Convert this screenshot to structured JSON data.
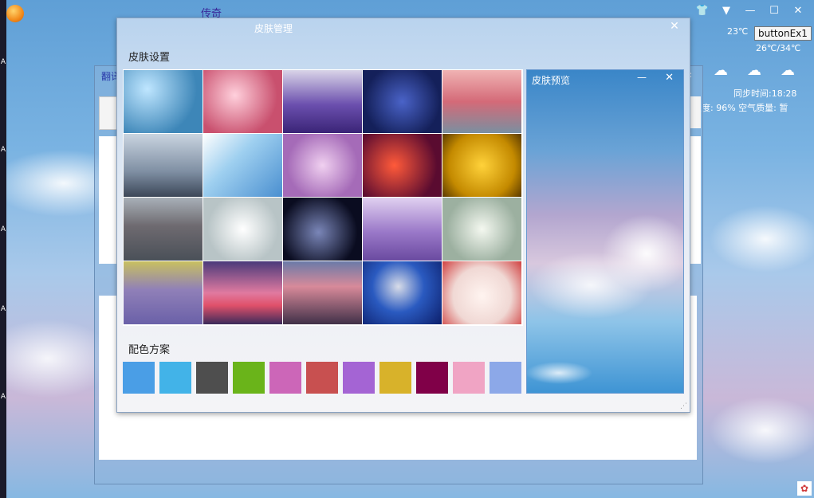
{
  "main": {
    "title": "传奇",
    "controls": [
      "👕",
      "▼",
      "—",
      "☐",
      "✕"
    ]
  },
  "tooltip": "buttonEx1",
  "weather": {
    "current_temp": "23℃",
    "range": "26℃/34℃",
    "sync_time": "同步时间:18:28",
    "humidity_air": "度: 96% 空气质量: 暂"
  },
  "background_window": {
    "title": "翻译"
  },
  "skin_manager": {
    "title": "皮肤管理",
    "close": "✕",
    "section_skin": "皮肤设置",
    "section_colors": "配色方案",
    "tiles": [
      {
        "name": "blue-bokeh",
        "bg": "radial-gradient(circle at 30% 30%,#bfe6ff,#3d86b8 70%)"
      },
      {
        "name": "pink-blossoms",
        "bg": "radial-gradient(circle at 40% 40%,#ffd0dc,#c9506e 70%)"
      },
      {
        "name": "lavender-field",
        "bg": "linear-gradient(180deg,#d9d4e8 0%,#6b4fae 55%,#3a2477 100%)"
      },
      {
        "name": "blueberries",
        "bg": "radial-gradient(circle at 50% 50%,#4a63c8,#14205a 75%)"
      },
      {
        "name": "pink-forest",
        "bg": "linear-gradient(180deg,#f0b3b3 0%,#d46a78 50%,#7a8fa0 100%)"
      },
      {
        "name": "cloud-sea",
        "bg": "linear-gradient(180deg,#c9d4e0 0%,#7f8fa3 60%,#3c4758 100%)"
      },
      {
        "name": "rainbow-sky",
        "bg": "linear-gradient(135deg,#fefefe 0%,#9fd0f0 40%,#4a8fd0 100%)"
      },
      {
        "name": "lilac-flowers",
        "bg": "radial-gradient(circle at 50% 50%,#f0d0f0,#a56bb8 70%)"
      },
      {
        "name": "red-bokeh",
        "bg": "radial-gradient(circle at 40% 50%,#ff5a3a,#5a0b30 75%)"
      },
      {
        "name": "sunflowers",
        "bg": "radial-gradient(circle at 50% 50%,#ffd23a,#c48a00 65%,#5a3a00 100%)"
      },
      {
        "name": "calm-lake",
        "bg": "linear-gradient(180deg,#a8b0b8 0%,#6e6a70 45%,#4a5058 100%)"
      },
      {
        "name": "white-splash",
        "bg": "radial-gradient(circle at 50% 50%,#ffffff,#b8c4c6 70%)"
      },
      {
        "name": "dark-planet",
        "bg": "radial-gradient(circle at 45% 55%,#7a86b8,#0a0c20 70%)"
      },
      {
        "name": "purple-trees",
        "bg": "linear-gradient(180deg,#e0d0f0 0%,#9a78c8 55%,#6a4aa0 100%)"
      },
      {
        "name": "daisies",
        "bg": "radial-gradient(circle at 50% 50%,#f4f8f0,#9cb0a0 70%)"
      },
      {
        "name": "purple-flowers-field",
        "bg": "linear-gradient(180deg,#c8c060 0%,#9080b8 45%,#6a60a8 100%)"
      },
      {
        "name": "lighthouse-sunset",
        "bg": "linear-gradient(180deg,#4a3a7a 0%,#e07aa0 50%,#e0506a 70%,#3a2a5a 100%)"
      },
      {
        "name": "beach-sunset",
        "bg": "linear-gradient(180deg,#6a7aa8 0%,#d88a9a 40%,#403048 100%)"
      },
      {
        "name": "blue-mask",
        "bg": "radial-gradient(circle at 45% 40%,#d8dce8,#2a5ac0 45%,#0c1e6a 100%)"
      },
      {
        "name": "strawberry-cake",
        "bg": "radial-gradient(circle at 50% 55%,#fff4f0,#f0d8d4 55%,#d04040 100%)"
      }
    ],
    "colors": [
      "#4a9ee6",
      "#42b3e8",
      "#4e4e4e",
      "#6ab41a",
      "#cc66b8",
      "#c85050",
      "#a464d4",
      "#d8b22a",
      "#800048",
      "#f0a4c4",
      "#8ca8e8"
    ]
  },
  "preview": {
    "title": "皮肤预览",
    "min": "—",
    "close": "✕"
  }
}
